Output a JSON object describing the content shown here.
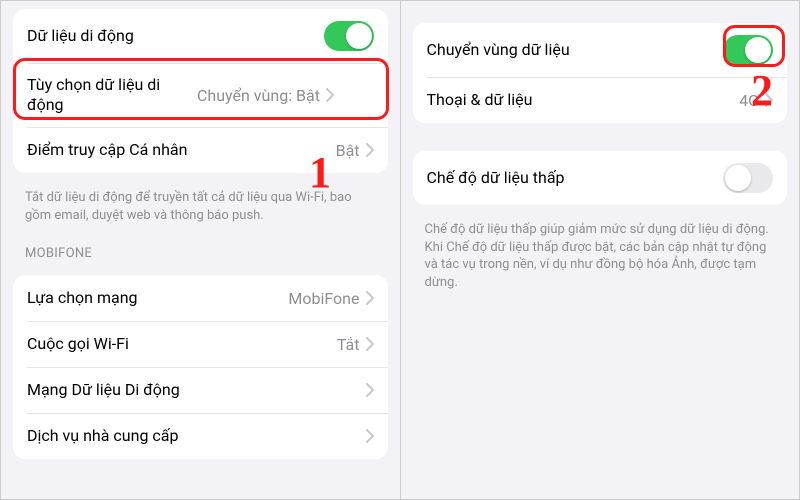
{
  "left": {
    "group1": {
      "cellular": {
        "label": "Dữ liệu di động",
        "on": true
      },
      "options": {
        "label": "Tùy chọn dữ liệu di động",
        "value": "Chuyển vùng: Bật"
      },
      "hotspot": {
        "label": "Điểm truy cập Cá nhân",
        "value": "Bật"
      }
    },
    "footer1": "Tắt dữ liệu di động để truyền tất cả dữ liệu qua Wi-Fi, bao gồm email, duyệt web và thông báo push.",
    "carrier_header": "MOBIFONE",
    "group2": {
      "network_selection": {
        "label": "Lựa chọn mạng",
        "value": "MobiFone"
      },
      "wifi_calling": {
        "label": "Cuộc gọi Wi-Fi",
        "value": "Tắt"
      },
      "cellular_network": {
        "label": "Mạng Dữ liệu Di động",
        "value": ""
      },
      "carrier_services": {
        "label": "Dịch vụ nhà cung cấp",
        "value": ""
      }
    }
  },
  "right": {
    "group1": {
      "roaming": {
        "label": "Chuyển vùng dữ liệu",
        "on": true
      },
      "voice_data": {
        "label": "Thoại & dữ liệu",
        "value": "4G"
      }
    },
    "group2": {
      "low_data": {
        "label": "Chế độ dữ liệu thấp",
        "on": false
      }
    },
    "footer2": "Chế độ dữ liệu thấp giúp giảm mức sử dụng dữ liệu di động. Khi Chế độ dữ liệu thấp được bật, các bản cập nhật tự động và tác vụ trong nền, ví dụ như đồng bộ hóa Ảnh, được tạm dừng."
  },
  "annotations": {
    "one": "1",
    "two": "2"
  }
}
